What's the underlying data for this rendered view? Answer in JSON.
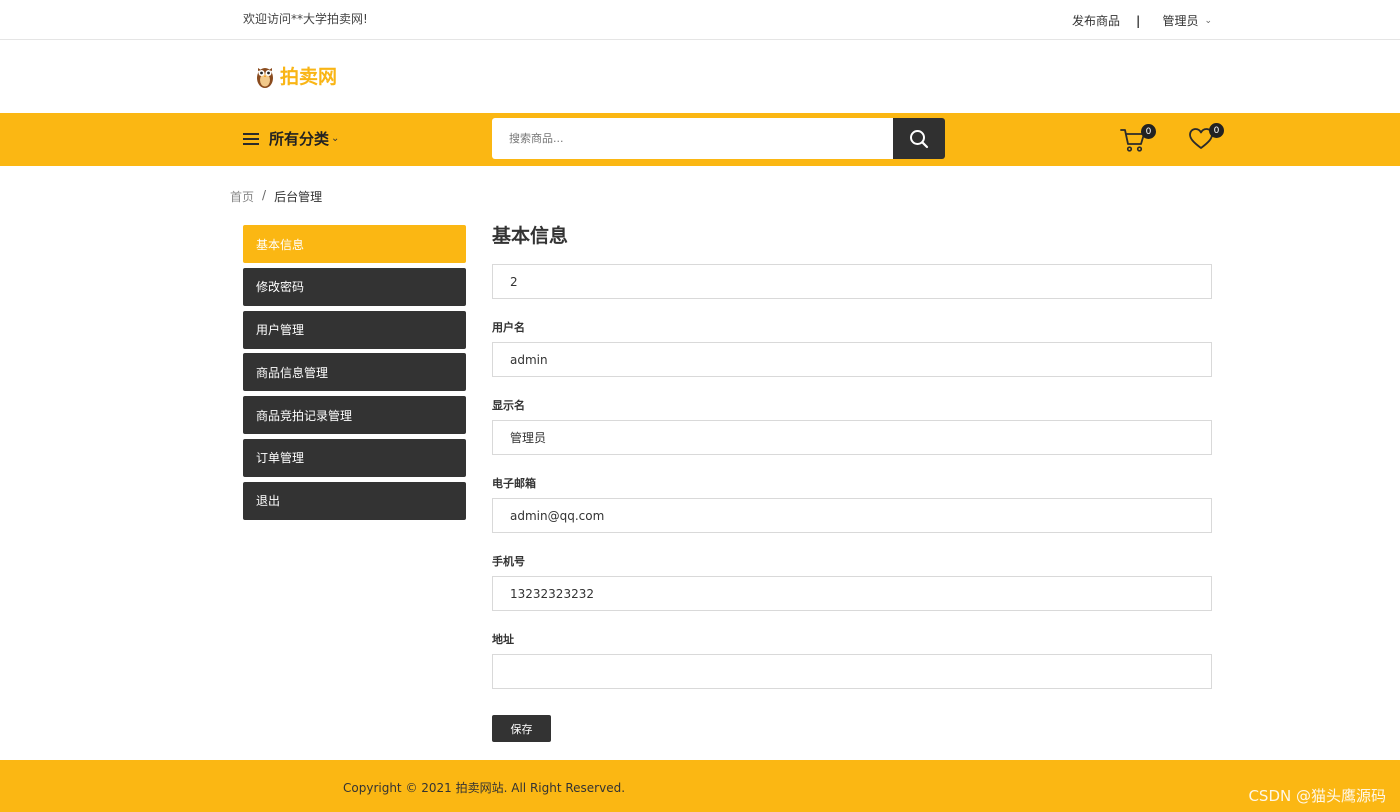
{
  "topbar": {
    "welcome": "欢迎访问**大学拍卖网!",
    "publish_link": "发布商品",
    "separator": "|",
    "user_menu": "管理员"
  },
  "logo": {
    "text": "拍卖网"
  },
  "nav": {
    "category_label": "所有分类",
    "search_placeholder": "搜索商品...",
    "cart_count": "0",
    "wishlist_count": "0"
  },
  "breadcrumb": {
    "home": "首页",
    "separator": "/",
    "current": "后台管理"
  },
  "sidebar": {
    "items": [
      {
        "label": "基本信息"
      },
      {
        "label": "修改密码"
      },
      {
        "label": "用户管理"
      },
      {
        "label": "商品信息管理"
      },
      {
        "label": "商品竞拍记录管理"
      },
      {
        "label": "订单管理"
      },
      {
        "label": "退出"
      }
    ]
  },
  "form": {
    "title": "基本信息",
    "id_value": "2",
    "username_label": "用户名",
    "username_value": "admin",
    "display_name_label": "显示名",
    "display_name_value": "管理员",
    "email_label": "电子邮箱",
    "email_value": "admin@qq.com",
    "phone_label": "手机号",
    "phone_value": "13232323232",
    "address_label": "地址",
    "address_value": "",
    "save_label": "保存"
  },
  "footer": {
    "copyright": "Copyright © 2021 拍卖网站. All Right Reserved.",
    "watermark": "CSDN @猫头鹰源码"
  },
  "colors": {
    "accent": "#fbb713",
    "dark": "#333333"
  }
}
